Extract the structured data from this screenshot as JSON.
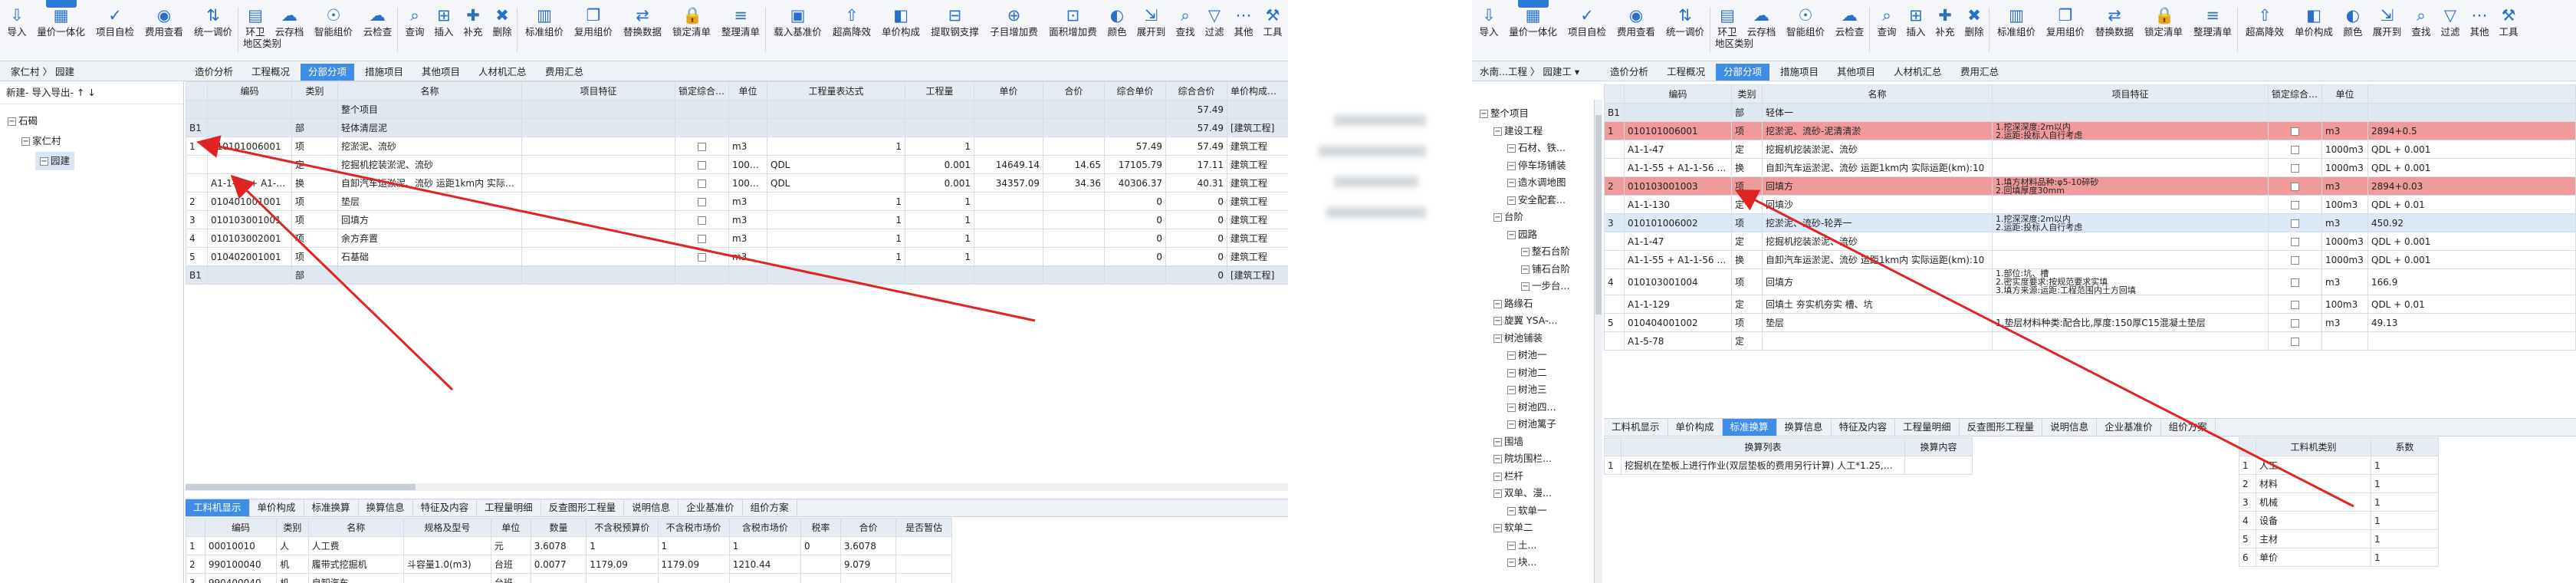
{
  "left": {
    "ribbon": [
      {
        "label": "导入",
        "icon": "⇩"
      },
      {
        "label": "量价一体化",
        "icon": "▦"
      },
      {
        "label": "项目自检",
        "icon": "✓"
      },
      {
        "label": "费用查看",
        "icon": "◉"
      },
      {
        "label": "统一调价",
        "icon": "⇅"
      },
      {
        "label": "环卫\n地区类别",
        "icon": "▤"
      },
      {
        "label": "云存档",
        "icon": "☁"
      },
      {
        "label": "智能组价",
        "icon": "☉"
      },
      {
        "label": "云检查",
        "icon": "☁"
      },
      {
        "label": "查询",
        "icon": "⌕"
      },
      {
        "label": "插入",
        "icon": "⊞"
      },
      {
        "label": "补充",
        "icon": "✚"
      },
      {
        "label": "删除",
        "icon": "✖"
      },
      {
        "label": "标准组价",
        "icon": "▥"
      },
      {
        "label": "复用组价",
        "icon": "❐"
      },
      {
        "label": "替换数据",
        "icon": "⇄"
      },
      {
        "label": "锁定清单",
        "icon": "🔒"
      },
      {
        "label": "整理清单",
        "icon": "≡"
      },
      {
        "label": "载入基准价",
        "icon": "▣"
      },
      {
        "label": "超高降效",
        "icon": "⇧"
      },
      {
        "label": "单价构成",
        "icon": "◧"
      },
      {
        "label": "提取钢支撑",
        "icon": "⊟"
      },
      {
        "label": "子目增加费",
        "icon": "⊕"
      },
      {
        "label": "面积增加费",
        "icon": "⊡"
      },
      {
        "label": "颜色",
        "icon": "◐"
      },
      {
        "label": "展开到",
        "icon": "⇲"
      },
      {
        "label": "查找",
        "icon": "⌕"
      },
      {
        "label": "过滤",
        "icon": "▽"
      },
      {
        "label": "其他",
        "icon": "⋯"
      },
      {
        "label": "工具",
        "icon": "⚒"
      }
    ],
    "breadcrumb": "家仁村 〉 园建",
    "tabs": [
      "造价分析",
      "工程概况",
      "分部分项",
      "措施项目",
      "其他项目",
      "人材机汇总",
      "费用汇总"
    ],
    "active_tab": "分部分项",
    "tree_toolbar": "新建- 导入导出-  ↑ ↓",
    "tree": [
      {
        "label": "石碣",
        "level": 0
      },
      {
        "label": "家仁村",
        "level": 1
      },
      {
        "label": "园建",
        "level": 2,
        "selected": true
      }
    ],
    "grid_headers": [
      "",
      "编码",
      "类别",
      "名称",
      "项目特征",
      "锁定综合单价",
      "单位",
      "工程量表达式",
      "工程量",
      "单价",
      "合价",
      "综合单价",
      "综合合价",
      "单价构成文件"
    ],
    "grid_rows": [
      {
        "type": "top",
        "cells": [
          "",
          "",
          "",
          "整个项目",
          "",
          "",
          "",
          "",
          "",
          "",
          "",
          "",
          "57.49",
          ""
        ]
      },
      {
        "type": "grp",
        "cells": [
          "B1",
          "",
          "部",
          "轻体清层泥",
          "",
          "",
          "",
          "",
          "",
          "",
          "",
          "",
          "57.49",
          "[建筑工程]"
        ]
      },
      {
        "type": "item",
        "cells": [
          "1",
          "010101006001",
          "项",
          "挖淤泥、流砂",
          "",
          "",
          "m3",
          "1",
          "1",
          "",
          "",
          "57.49",
          "57.49",
          "建筑工程"
        ]
      },
      {
        "type": "sub",
        "cells": [
          "",
          "",
          "定",
          "挖掘机挖装淤泥、流砂",
          "",
          "",
          "1000m3",
          "QDL",
          "0.001",
          "14649.14",
          "14.65",
          "17105.79",
          "17.11",
          "建筑工程"
        ]
      },
      {
        "type": "sub",
        "cells": [
          "",
          "A1-1-55 + A1-1-56 * 9",
          "换",
          "自卸汽车运淤泥、流砂 运距1km内  实际运距",
          "",
          "",
          "1000m3",
          "QDL",
          "0.001",
          "34357.09",
          "34.36",
          "40306.37",
          "40.31",
          "建筑工程"
        ]
      },
      {
        "type": "item",
        "cells": [
          "2",
          "010401001001",
          "项",
          "垫层",
          "",
          "",
          "m3",
          "1",
          "1",
          "",
          "",
          "0",
          "0",
          "建筑工程"
        ]
      },
      {
        "type": "item",
        "cells": [
          "3",
          "010103001001",
          "项",
          "回填方",
          "",
          "",
          "m3",
          "1",
          "1",
          "",
          "",
          "0",
          "0",
          "建筑工程"
        ]
      },
      {
        "type": "item",
        "cells": [
          "4",
          "010103002001",
          "项",
          "余方弃置",
          "",
          "",
          "m3",
          "1",
          "1",
          "",
          "",
          "0",
          "0",
          "建筑工程"
        ]
      },
      {
        "type": "item",
        "cells": [
          "5",
          "010402001001",
          "项",
          "石基础",
          "",
          "",
          "m3",
          "1",
          "1",
          "",
          "",
          "0",
          "0",
          "建筑工程"
        ]
      },
      {
        "type": "grp",
        "cells": [
          "B1",
          "",
          "部",
          "",
          "",
          "",
          "",
          "",
          "",
          "",
          "",
          "",
          "0",
          "[建筑工程]"
        ]
      }
    ],
    "bottom_tabs": [
      "工料机显示",
      "单价构成",
      "标准换算",
      "换算信息",
      "特征及内容",
      "工程量明细",
      "反查图形工程量",
      "说明信息",
      "企业基准价",
      "组价方案"
    ],
    "bottom_active": "工料机显示",
    "bottom_headers": [
      "",
      "编码",
      "类别",
      "名称",
      "规格及型号",
      "单位",
      "数量",
      "不含税预算价",
      "不含税市场价",
      "含税市场价",
      "税率",
      "合价",
      "是否暂估"
    ],
    "bottom_rows": [
      [
        "1",
        "00010010",
        "人",
        "人工费",
        "",
        "元",
        "3.6078",
        "1",
        "1",
        "1",
        "0",
        "3.6078",
        ""
      ],
      [
        "2",
        "990100040",
        "机",
        "履带式挖掘机",
        "斗容量1.0(m3)",
        "台班",
        "0.0077",
        "1179.09",
        "1179.09",
        "1210.44",
        "",
        "9.079",
        ""
      ],
      [
        "3",
        "990400040",
        "机",
        "自卸汽车",
        "",
        "台班",
        "",
        "",
        "",
        "",
        "",
        "",
        ""
      ]
    ]
  },
  "right": {
    "ribbon": [
      {
        "label": "导入",
        "icon": "⇩"
      },
      {
        "label": "量价一体化",
        "icon": "▦"
      },
      {
        "label": "项目自检",
        "icon": "✓"
      },
      {
        "label": "费用查看",
        "icon": "◉"
      },
      {
        "label": "统一调价",
        "icon": "⇅"
      },
      {
        "label": "环卫\n地区类别",
        "icon": "▤"
      },
      {
        "label": "云存档",
        "icon": "☁"
      },
      {
        "label": "智能组价",
        "icon": "☉"
      },
      {
        "label": "云检查",
        "icon": "☁"
      },
      {
        "label": "查询",
        "icon": "⌕"
      },
      {
        "label": "插入",
        "icon": "⊞"
      },
      {
        "label": "补充",
        "icon": "✚"
      },
      {
        "label": "删除",
        "icon": "✖"
      },
      {
        "label": "标准组价",
        "icon": "▥"
      },
      {
        "label": "复用组价",
        "icon": "❐"
      },
      {
        "label": "替换数据",
        "icon": "⇄"
      },
      {
        "label": "锁定清单",
        "icon": "🔒"
      },
      {
        "label": "整理清单",
        "icon": "≡"
      },
      {
        "label": "超高降效",
        "icon": "⇧"
      },
      {
        "label": "单价构成",
        "icon": "◧"
      },
      {
        "label": "颜色",
        "icon": "◐"
      },
      {
        "label": "展开到",
        "icon": "⇲"
      },
      {
        "label": "查找",
        "icon": "⌕"
      },
      {
        "label": "过滤",
        "icon": "▽"
      },
      {
        "label": "其他",
        "icon": "⋯"
      },
      {
        "label": "工具",
        "icon": "⚒"
      }
    ],
    "breadcrumb": "水南...工程 〉 园建工 ▾",
    "tabs": [
      "造价分析",
      "工程概况",
      "分部分项",
      "措施项目",
      "其他项目",
      "人材机汇总",
      "费用汇总"
    ],
    "active_tab": "分部分项",
    "tree": [
      {
        "label": "整个项目",
        "level": 0
      },
      {
        "label": "建设工程",
        "level": 1
      },
      {
        "label": "石材、铁...",
        "level": 2
      },
      {
        "label": "停车场铺装",
        "level": 2
      },
      {
        "label": "造水调地图",
        "level": 2
      },
      {
        "label": "安全配套...",
        "level": 2
      },
      {
        "label": "台阶",
        "level": 1
      },
      {
        "label": "园路",
        "level": 2
      },
      {
        "label": "整石台阶",
        "level": 3
      },
      {
        "label": "铺石台阶",
        "level": 3
      },
      {
        "label": "一步台...",
        "level": 3
      },
      {
        "label": "路缘石",
        "level": 1
      },
      {
        "label": "旋翼 YSA-...",
        "level": 1
      },
      {
        "label": "树池铺装",
        "level": 1
      },
      {
        "label": "树池一",
        "level": 2
      },
      {
        "label": "树池二",
        "level": 2
      },
      {
        "label": "树池三",
        "level": 2
      },
      {
        "label": "树池四...",
        "level": 2
      },
      {
        "label": "树池篱子",
        "level": 2
      },
      {
        "label": "围墙",
        "level": 1
      },
      {
        "label": "院坊围栏...",
        "level": 1
      },
      {
        "label": "栏杆",
        "level": 1
      },
      {
        "label": "双单、漫...",
        "level": 1
      },
      {
        "label": "软单一",
        "level": 2
      },
      {
        "label": "软单二",
        "level": 1
      },
      {
        "label": "土...",
        "level": 2
      },
      {
        "label": "块...",
        "level": 2
      }
    ],
    "grid_headers": [
      "",
      "编码",
      "类别",
      "名称",
      "项目特征",
      "锁定综合单价",
      "单位"
    ],
    "grid_rows": [
      {
        "type": "grp",
        "cells": [
          "B1",
          "",
          "部",
          "轻体一",
          "",
          "",
          ""
        ]
      },
      {
        "type": "red",
        "cells": [
          "1",
          "010101006001",
          "项",
          "挖淤泥、流砂-泥清清淤",
          "1.挖深深度:2m以内\n2.运距:投标人自行考虑",
          "",
          "m3"
        ]
      },
      {
        "type": "sub",
        "cells": [
          "",
          "A1-1-47",
          "定",
          "挖掘机挖装淤泥、流砂",
          "",
          "",
          "1000m3"
        ]
      },
      {
        "type": "sub",
        "cells": [
          "",
          "A1-1-55 + A1-1-56 * 9",
          "换",
          "自卸汽车运淤泥、流砂 运距1km内  实际运距(km):10",
          "",
          "",
          "1000m3"
        ]
      },
      {
        "type": "red",
        "cells": [
          "2",
          "010103001003",
          "项",
          "回填方",
          "1.填方材料品种:φ5-10碎砂\n2.回填厚度30mm",
          "",
          "m3"
        ]
      },
      {
        "type": "sub",
        "cells": [
          "",
          "A1-1-130",
          "定",
          "回填沙",
          "",
          "",
          "100m3"
        ]
      },
      {
        "type": "blue",
        "cells": [
          "3",
          "010101006002",
          "项",
          "挖淤泥、流砂-轮弄一",
          "1.挖深深度:2m以内\n2.运距:投标人自行考虑",
          "",
          "m3"
        ]
      },
      {
        "type": "sub",
        "cells": [
          "",
          "A1-1-47",
          "定",
          "挖掘机挖装淤泥、流砂",
          "",
          "",
          "1000m3"
        ]
      },
      {
        "type": "sub",
        "cells": [
          "",
          "A1-1-55 + A1-1-56 * 9",
          "换",
          "自卸汽车运淤泥、流砂 运距1km内  实际运距(km):10",
          "",
          "",
          "1000m3"
        ]
      },
      {
        "type": "item",
        "cells": [
          "4",
          "010103001004",
          "项",
          "回填方",
          "1.部位:坑、槽\n2.密实度要求:按规范要求实填\n3.填方来源:运距:工程范围内土方回填",
          "",
          "m3"
        ]
      },
      {
        "type": "sub",
        "cells": [
          "",
          "A1-1-129",
          "定",
          "回填土 夯实机夯实 槽、坑",
          "",
          "",
          "100m3"
        ]
      },
      {
        "type": "item",
        "cells": [
          "5",
          "010404001002",
          "项",
          "垫层",
          "1.垫层材料种类:配合比,厚度:150厚C15混凝土垫层",
          "",
          "m3"
        ]
      },
      {
        "type": "sub",
        "cells": [
          "",
          "A1-5-78",
          "定",
          "",
          "",
          "",
          ""
        ]
      }
    ],
    "right_values": [
      [
        "2894+0.5"
      ],
      [
        "QDL + 0.001"
      ],
      [
        "QDL + 0.001"
      ],
      [
        "2894+0.03"
      ],
      [
        "QDL + 0.01"
      ],
      [
        "450.92"
      ],
      [
        "QDL + 0.001"
      ],
      [
        "QDL + 0.001"
      ],
      [
        "166.9"
      ],
      [
        "QDL + 0.01"
      ],
      [
        "49.13"
      ],
      [
        ""
      ]
    ],
    "bottom_tabs": [
      "工料机显示",
      "单价构成",
      "标准换算",
      "换算信息",
      "特征及内容",
      "工程量明细",
      "反查图形工程量",
      "说明信息",
      "企业基准价",
      "组价方案"
    ],
    "bottom_active": "标准换算",
    "conv_headers": [
      "",
      "换算列表",
      "换算内容"
    ],
    "conv_rows": [
      [
        "1",
        "挖掘机在垫板上进行作业(双层垫板的费用另行计算) 人工*1.25,机械*1.25",
        ""
      ]
    ],
    "cat_headers": [
      "",
      "工料机类别",
      "系数"
    ],
    "cat_rows": [
      [
        "1",
        "人工",
        "1"
      ],
      [
        "2",
        "材料",
        "1"
      ],
      [
        "3",
        "机械",
        "1"
      ],
      [
        "4",
        "设备",
        "1"
      ],
      [
        "5",
        "主材",
        "1"
      ],
      [
        "6",
        "单价",
        "1"
      ]
    ]
  }
}
